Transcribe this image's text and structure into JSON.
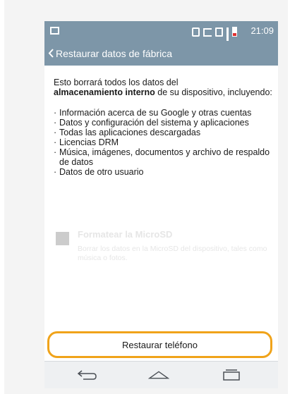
{
  "status_bar": {
    "time": "21:09",
    "icons": [
      "gallery-icon",
      "nfc-icon",
      "vibrate-icon",
      "mobile-data-icon",
      "signal-icon",
      "battery-low-icon"
    ],
    "battery_color": "#e03030"
  },
  "app_bar": {
    "back_icon": "chevron-left-icon",
    "title": "Restaurar datos de fábrica",
    "color": "#7d96a8"
  },
  "content": {
    "intro_before": "Esto borrará todos los datos del",
    "intro_bold": "almacenamiento interno",
    "intro_after": " de su dispositivo, incluyendo:",
    "bullets": [
      "Información acerca de su Google y otras cuentas",
      "Datos y configuración del sistema y aplicaciones",
      "Todas las aplicaciones descargadas",
      "Licencias DRM",
      "Música, imágenes, documentos y archivo de respaldo de datos",
      "Datos de otro usuario"
    ]
  },
  "format_sd": {
    "label": "Formatear la MicroSD",
    "description": "Borrar los datos en la MicroSD del dispositivo, tales como música o fotos.",
    "checked": false,
    "enabled": false
  },
  "restore_button": {
    "label": "Restaurar teléfono",
    "highlight_color": "#f0a31a"
  },
  "nav_bar": {
    "icons": [
      "back-icon",
      "home-icon",
      "recent-apps-icon"
    ]
  }
}
